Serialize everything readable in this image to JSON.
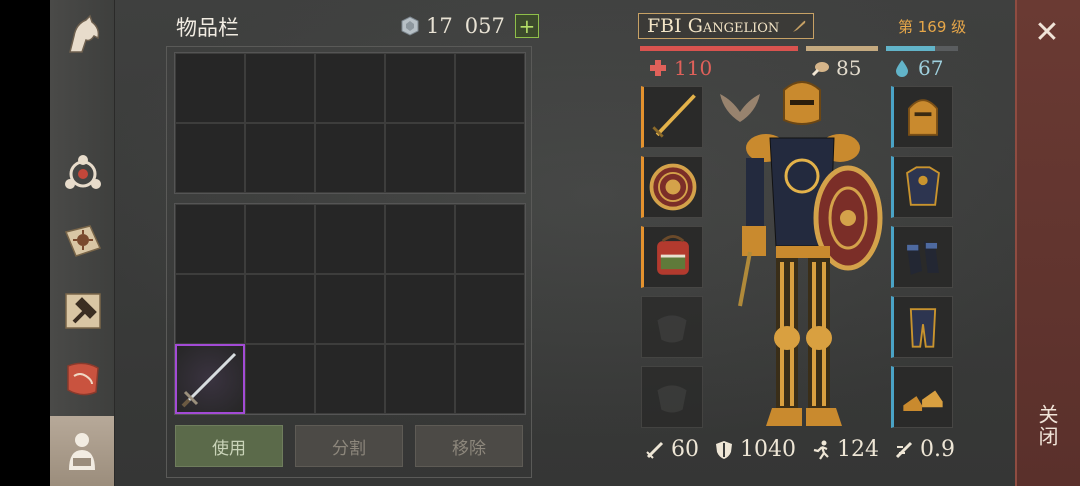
{
  "inventory": {
    "title": "物品栏",
    "coins": "17",
    "coins_alt": "057",
    "buttons": {
      "use": "使用",
      "split": "分割",
      "remove": "移除"
    }
  },
  "character": {
    "name": "FBI Gangelion",
    "level": "第 169 级",
    "hp": "110",
    "food": "85",
    "water": "67",
    "hp_fraction": 1.0,
    "food_fraction": 1.0,
    "water_fraction": 0.68,
    "stats": {
      "attack": "60",
      "defense": "1040",
      "speed": "124",
      "crit": "0.9"
    }
  },
  "close": {
    "label": "关闭"
  },
  "colors": {
    "hp": "#d9534f",
    "food": "#c5aa80",
    "water": "#62b4c9",
    "rare_purple": "#a34bd6",
    "slot_orange": "#e4922e",
    "slot_blue": "#4aa3c6"
  }
}
